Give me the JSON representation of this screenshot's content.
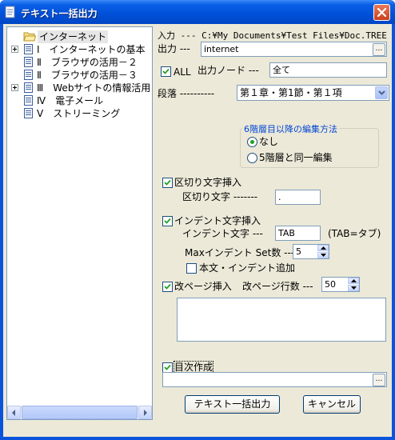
{
  "window": {
    "title": "テキスト一括出力"
  },
  "tree": {
    "items": [
      {
        "label": "インターネット",
        "type": "folder",
        "expander": false,
        "selected": true
      },
      {
        "label": "Ⅰ　インターネットの基本",
        "type": "doc",
        "expander": true
      },
      {
        "label": "Ⅱ　ブラウザの活用－２",
        "type": "doc",
        "expander": false
      },
      {
        "label": "Ⅱ　ブラウザの活用－３",
        "type": "doc",
        "expander": false
      },
      {
        "label": "Ⅲ　Webサイトの情報活用",
        "type": "doc",
        "expander": true
      },
      {
        "label": "Ⅳ　電子メール",
        "type": "doc",
        "expander": false
      },
      {
        "label": "Ⅴ　ストリーミング",
        "type": "doc",
        "expander": false
      }
    ]
  },
  "input_row": {
    "label": "入力 --- C:¥My Documents¥Test Files¥Doc.TREE"
  },
  "output_row": {
    "label": "出力 ---",
    "value": "internet",
    "browse": "…"
  },
  "all_option": {
    "label": "ALL",
    "checked": true
  },
  "output_node": {
    "label": "出力ノード ---",
    "value": "全て"
  },
  "paragraph": {
    "label": "段落 ----------",
    "selected": "第１章・第1節・第１項"
  },
  "level6_group": {
    "title": "6階層目以降の編集方法",
    "options": [
      {
        "label": "なし",
        "selected": true
      },
      {
        "label": "5階層と同一編集",
        "selected": false
      }
    ]
  },
  "separator": {
    "checkbox_label": "区切り文字挿入",
    "checked": true,
    "label": "区切り文字 -------",
    "value": "."
  },
  "indent": {
    "checkbox_label": "インデント文字挿入",
    "checked": true,
    "label": "インデント文字 ---",
    "value": "TAB",
    "hint": "(TAB=タブ)",
    "max_label": "Maxインデント Set数 ---",
    "max_value": "5",
    "body_indent_label": "本文・インデント追加",
    "body_indent_checked": false
  },
  "page_break": {
    "checkbox_label": "改ページ挿入",
    "checked": true,
    "lines_label": "改ページ行数 ---",
    "lines_value": "50"
  },
  "toc": {
    "checkbox_label": "目次作成",
    "checked": true,
    "value": "",
    "browse": "…"
  },
  "buttons": {
    "export": "テキスト一括出力",
    "cancel": "キャンセル"
  },
  "colors": {
    "title_bar": "#0a53dd",
    "dialog_bg": "#ece9d8",
    "group_title": "#0046d5",
    "radio_dot": "#21a121"
  }
}
